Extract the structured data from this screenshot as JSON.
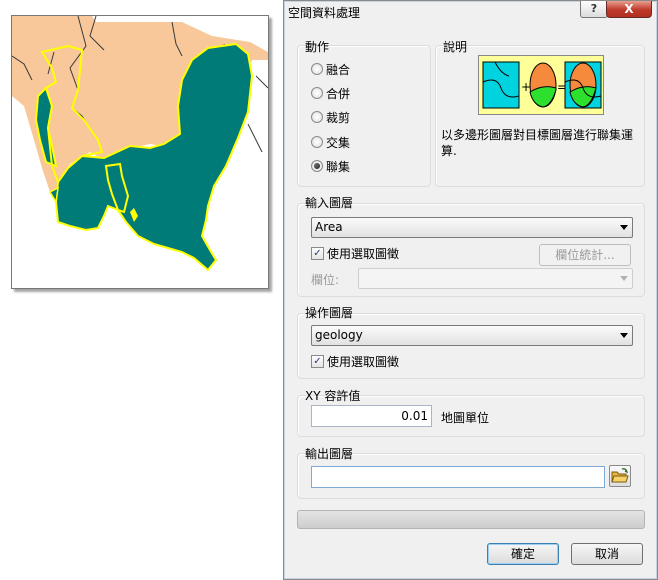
{
  "dialog": {
    "title": "空間資料處理",
    "help_label": "?",
    "close_label": "X"
  },
  "operation": {
    "group_label": "動作",
    "options": [
      {
        "label": "融合",
        "selected": false
      },
      {
        "label": "合併",
        "selected": false
      },
      {
        "label": "裁剪",
        "selected": false
      },
      {
        "label": "交集",
        "selected": false
      },
      {
        "label": "聯集",
        "selected": true
      }
    ]
  },
  "description": {
    "group_label": "說明",
    "text": "以多邊形圖層對目標圖層進行聯集運算.",
    "illustration_icon": "union-diagram-icon"
  },
  "input_layer": {
    "group_label": "輸入圖層",
    "selected": "Area",
    "use_selected_label": "使用選取圖徵",
    "use_selected_checked": true,
    "field_stats_label": "欄位統計...",
    "field_label": "欄位:",
    "field_value": ""
  },
  "overlay_layer": {
    "group_label": "操作圖層",
    "selected": "geology",
    "use_selected_label": "使用選取圖徵",
    "use_selected_checked": true
  },
  "tolerance": {
    "group_label": "XY 容許值",
    "value": "0.01",
    "unit": "地圖單位"
  },
  "output_layer": {
    "group_label": "輸出圖層",
    "value": "",
    "browse_icon": "folder-open-icon"
  },
  "progress": {
    "value": 0
  },
  "buttons": {
    "ok": "確定",
    "cancel": "取消"
  },
  "colors": {
    "land": "#f9c89a",
    "water": "#007b78",
    "outline": "#ffff00"
  }
}
